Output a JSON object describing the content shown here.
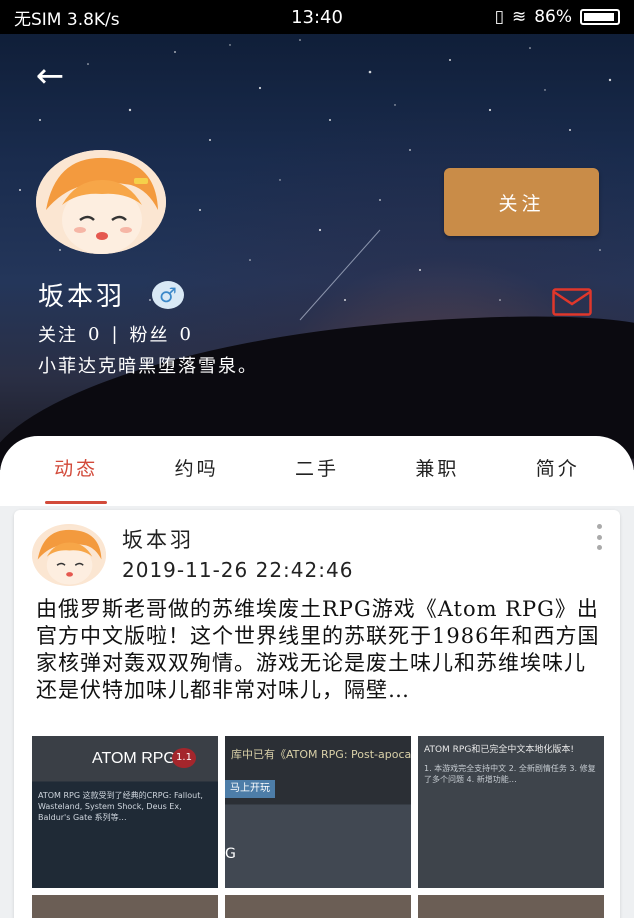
{
  "status_bar": {
    "carrier": "无SIM 3.8K/s",
    "time": "13:40",
    "battery": "86%"
  },
  "profile": {
    "name": "坂本羽",
    "gender_symbol": "♂",
    "follow_label": "关注",
    "following_label": "关注",
    "following_count": "0",
    "separator": "|",
    "followers_label": "粉丝",
    "followers_count": "0",
    "bio": "小菲达克暗黑堕落雪泉。"
  },
  "tabs": [
    {
      "label": "动态",
      "active": true
    },
    {
      "label": "约吗",
      "active": false
    },
    {
      "label": "二手",
      "active": false
    },
    {
      "label": "兼职",
      "active": false
    },
    {
      "label": "简介",
      "active": false
    }
  ],
  "post": {
    "author": "坂本羽",
    "timestamp": "2019-11-26 22:42:46",
    "text": "由俄罗斯老哥做的苏维埃废土RPG游戏《Atom RPG》出官方中文版啦！这个世界线里的苏联死于1986年和西方国家核弹对轰双双殉情。游戏无论是废土味儿和苏维埃味儿还是伏特加味儿都非常对味儿，隔壁…",
    "images": [
      {
        "title": "ATOM RPG",
        "badge": "1.1",
        "desc": "ATOM RPG 这款受到了经典的CRPG: Fallout, Wasteland, System Shock, Deus Ex, Baldur's Gate 系列等…"
      },
      {
        "head": "库中已有《ATOM RPG: Post-apoca",
        "button": "马上开玩",
        "letter": "G"
      },
      {
        "head": "ATOM RPG和已完全中文本地化版本!",
        "lines": "1. 本游戏完全支持中文 2. 全新剧情任务 3. 修复了多个问题 4. 新增功能…"
      }
    ]
  },
  "colors": {
    "accent": "#d24a3a",
    "follow_button": "#c98c48",
    "gender": "#3b88c9"
  }
}
